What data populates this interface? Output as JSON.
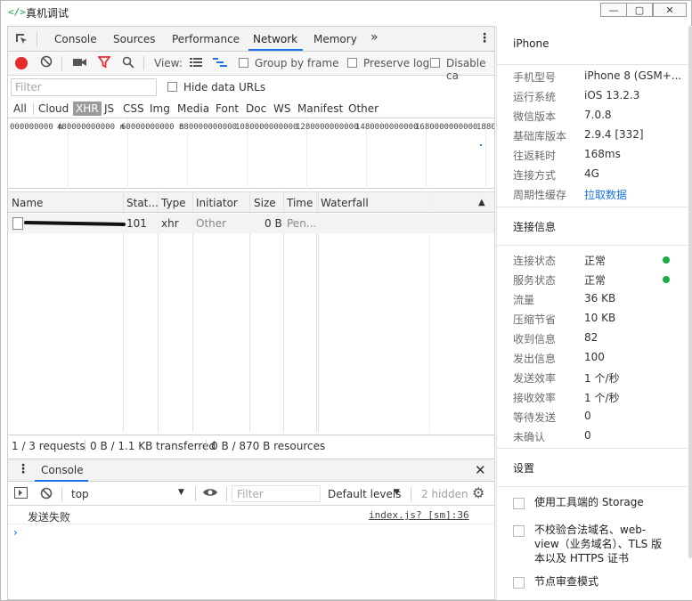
{
  "window": {
    "title": "真机调试",
    "icon": "code-brackets-icon"
  },
  "devtools": {
    "tabs": [
      "Console",
      "Sources",
      "Performance",
      "Network",
      "Memory"
    ],
    "active_tab": "Network",
    "more_tabs_glyph": "»",
    "toolbar": {
      "view_label": "View:",
      "group_by_frame": "Group by frame",
      "preserve_log": "Preserve log",
      "disable_cache": "Disable ca"
    },
    "filter": {
      "placeholder": "Filter",
      "hide_data_urls": "Hide data URLs"
    },
    "types": [
      "All",
      "Cloud",
      "XHR",
      "JS",
      "CSS",
      "Img",
      "Media",
      "Font",
      "Doc",
      "WS",
      "Manifest",
      "Other"
    ],
    "active_type": "XHR",
    "overview_labels": [
      "000000000 n",
      "480000000000 n",
      "60000000000 n",
      "880000000000",
      "1080000000000",
      "1280000000000",
      "1480000000000",
      "1680000000000",
      "1880"
    ],
    "columns": [
      "Name",
      "Stat...",
      "Type",
      "Initiator",
      "Size",
      "Time",
      "Waterfall"
    ],
    "requests": [
      {
        "name": "",
        "status": "101",
        "type": "xhr",
        "initiator": "Other",
        "size": "0 B",
        "time": "Pen..."
      }
    ],
    "status_bar": {
      "requests": "1 / 3 requests",
      "transferred": "0 B / 1.1 KB transferred",
      "resources": "0 B / 870 B resources"
    },
    "drawer": {
      "tab": "Console",
      "context": "top",
      "filter_placeholder": "Filter",
      "levels": "Default levels",
      "hidden": "2 hidden",
      "messages": [
        {
          "text": "发送失败",
          "source": "index.js? [sm]:36"
        }
      ],
      "prompt": "›"
    }
  },
  "sidebar": {
    "device_title": "iPhone",
    "device_info": [
      {
        "label": "手机型号",
        "value": "iPhone 8 (GSM+..."
      },
      {
        "label": "运行系统",
        "value": "iOS 13.2.3"
      },
      {
        "label": "微信版本",
        "value": "7.0.8"
      },
      {
        "label": "基础库版本",
        "value": "2.9.4 [332]"
      },
      {
        "label": "往返耗时",
        "value": "168ms"
      },
      {
        "label": "连接方式",
        "value": "4G"
      },
      {
        "label": "周期性缓存",
        "value": "拉取数据"
      }
    ],
    "connection_title": "连接信息",
    "connection_info": [
      {
        "label": "连接状态",
        "value": "正常"
      },
      {
        "label": "服务状态",
        "value": "正常"
      },
      {
        "label": "流量",
        "value": "36 KB"
      },
      {
        "label": "压缩节省",
        "value": "10 KB"
      },
      {
        "label": "收到信息",
        "value": "82"
      },
      {
        "label": "发出信息",
        "value": "100"
      },
      {
        "label": "发送效率",
        "value": "1 个/秒"
      },
      {
        "label": "接收效率",
        "value": "1 个/秒"
      },
      {
        "label": "等待发送",
        "value": "0"
      },
      {
        "label": "未确认",
        "value": "0"
      }
    ],
    "settings_title": "设置",
    "settings": [
      "使用工具端的 Storage",
      "不校验合法域名、web-view（业务域名）、TLS 版本以及 HTTPS 证书",
      "节点审查模式"
    ],
    "status_color": "#1aad4a",
    "link_color": "#1a73e8"
  }
}
